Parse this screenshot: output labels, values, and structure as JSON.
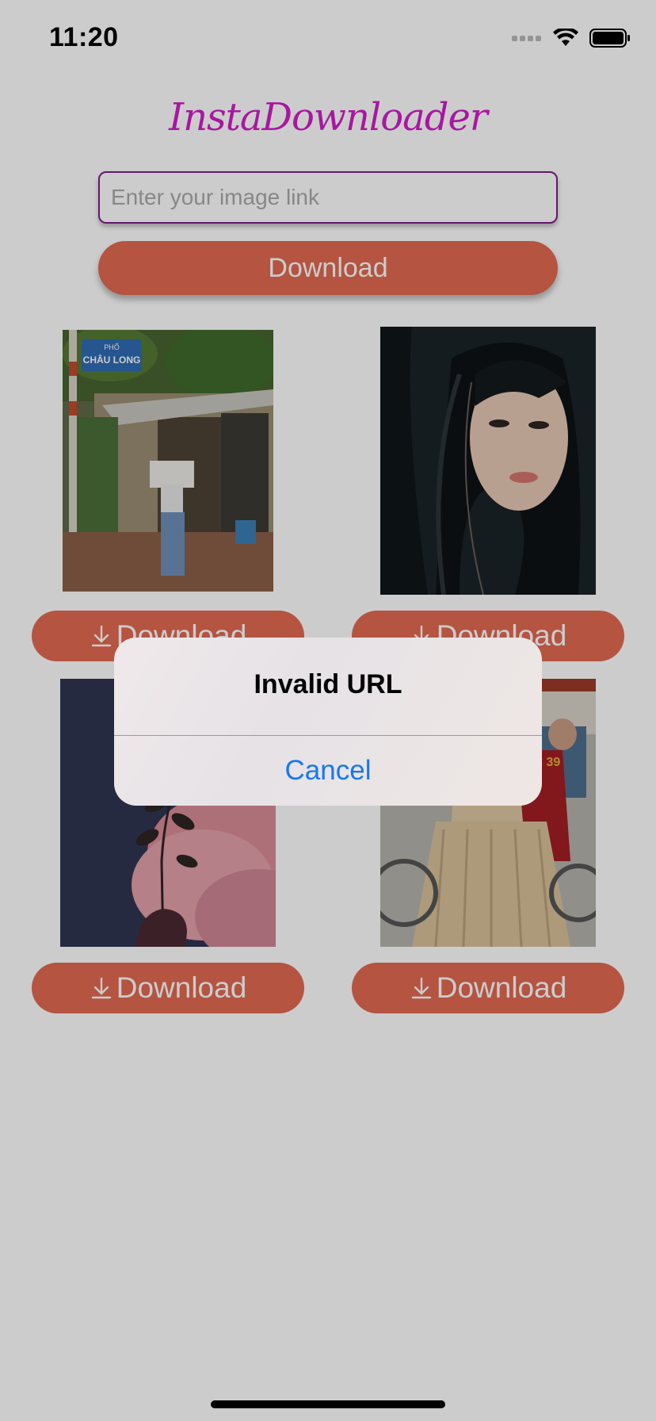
{
  "status_bar": {
    "time": "11:20"
  },
  "app": {
    "title": "InstaDownloader"
  },
  "url_input": {
    "placeholder": "Enter your image link",
    "value": ""
  },
  "main_button": {
    "label": "Download"
  },
  "gallery": {
    "items": [
      {
        "photo": "street-newspaper-photo",
        "button_label": "Download",
        "sign_line1": "PHỐ",
        "sign_line2": "CHÂU LONG"
      },
      {
        "photo": "portrait-long-hair-photo",
        "button_label": "Download"
      },
      {
        "photo": "hand-plant-pink-cloud-photo",
        "button_label": "Download"
      },
      {
        "photo": "woman-cyclo-photo",
        "button_label": "Download",
        "plate": "SC 39"
      }
    ]
  },
  "alert": {
    "title": "Invalid URL",
    "cancel_label": "Cancel"
  },
  "colors": {
    "title": "#d21dc9",
    "button": "#e16a52",
    "input_border": "#7d1f86",
    "alert_action": "#1778f2"
  }
}
